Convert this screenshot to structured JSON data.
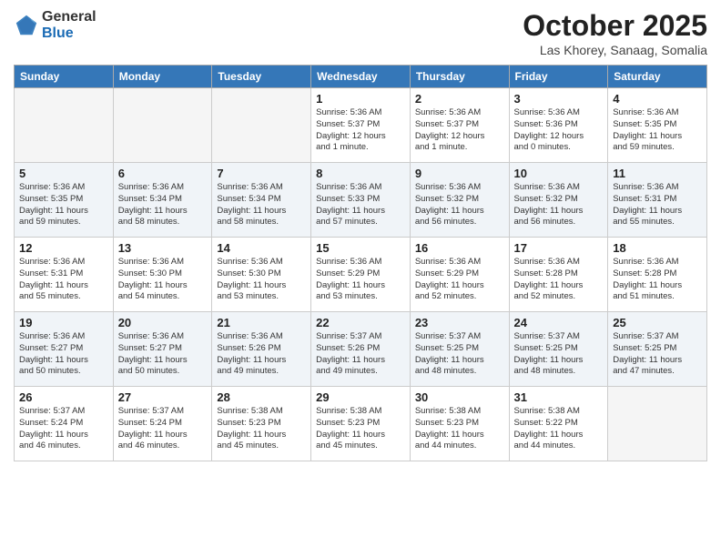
{
  "logo": {
    "general": "General",
    "blue": "Blue"
  },
  "header": {
    "month": "October 2025",
    "location": "Las Khorey, Sanaag, Somalia"
  },
  "weekdays": [
    "Sunday",
    "Monday",
    "Tuesday",
    "Wednesday",
    "Thursday",
    "Friday",
    "Saturday"
  ],
  "weeks": [
    [
      {
        "day": "",
        "info": ""
      },
      {
        "day": "",
        "info": ""
      },
      {
        "day": "",
        "info": ""
      },
      {
        "day": "1",
        "info": "Sunrise: 5:36 AM\nSunset: 5:37 PM\nDaylight: 12 hours\nand 1 minute."
      },
      {
        "day": "2",
        "info": "Sunrise: 5:36 AM\nSunset: 5:37 PM\nDaylight: 12 hours\nand 1 minute."
      },
      {
        "day": "3",
        "info": "Sunrise: 5:36 AM\nSunset: 5:36 PM\nDaylight: 12 hours\nand 0 minutes."
      },
      {
        "day": "4",
        "info": "Sunrise: 5:36 AM\nSunset: 5:35 PM\nDaylight: 11 hours\nand 59 minutes."
      }
    ],
    [
      {
        "day": "5",
        "info": "Sunrise: 5:36 AM\nSunset: 5:35 PM\nDaylight: 11 hours\nand 59 minutes."
      },
      {
        "day": "6",
        "info": "Sunrise: 5:36 AM\nSunset: 5:34 PM\nDaylight: 11 hours\nand 58 minutes."
      },
      {
        "day": "7",
        "info": "Sunrise: 5:36 AM\nSunset: 5:34 PM\nDaylight: 11 hours\nand 58 minutes."
      },
      {
        "day": "8",
        "info": "Sunrise: 5:36 AM\nSunset: 5:33 PM\nDaylight: 11 hours\nand 57 minutes."
      },
      {
        "day": "9",
        "info": "Sunrise: 5:36 AM\nSunset: 5:32 PM\nDaylight: 11 hours\nand 56 minutes."
      },
      {
        "day": "10",
        "info": "Sunrise: 5:36 AM\nSunset: 5:32 PM\nDaylight: 11 hours\nand 56 minutes."
      },
      {
        "day": "11",
        "info": "Sunrise: 5:36 AM\nSunset: 5:31 PM\nDaylight: 11 hours\nand 55 minutes."
      }
    ],
    [
      {
        "day": "12",
        "info": "Sunrise: 5:36 AM\nSunset: 5:31 PM\nDaylight: 11 hours\nand 55 minutes."
      },
      {
        "day": "13",
        "info": "Sunrise: 5:36 AM\nSunset: 5:30 PM\nDaylight: 11 hours\nand 54 minutes."
      },
      {
        "day": "14",
        "info": "Sunrise: 5:36 AM\nSunset: 5:30 PM\nDaylight: 11 hours\nand 53 minutes."
      },
      {
        "day": "15",
        "info": "Sunrise: 5:36 AM\nSunset: 5:29 PM\nDaylight: 11 hours\nand 53 minutes."
      },
      {
        "day": "16",
        "info": "Sunrise: 5:36 AM\nSunset: 5:29 PM\nDaylight: 11 hours\nand 52 minutes."
      },
      {
        "day": "17",
        "info": "Sunrise: 5:36 AM\nSunset: 5:28 PM\nDaylight: 11 hours\nand 52 minutes."
      },
      {
        "day": "18",
        "info": "Sunrise: 5:36 AM\nSunset: 5:28 PM\nDaylight: 11 hours\nand 51 minutes."
      }
    ],
    [
      {
        "day": "19",
        "info": "Sunrise: 5:36 AM\nSunset: 5:27 PM\nDaylight: 11 hours\nand 50 minutes."
      },
      {
        "day": "20",
        "info": "Sunrise: 5:36 AM\nSunset: 5:27 PM\nDaylight: 11 hours\nand 50 minutes."
      },
      {
        "day": "21",
        "info": "Sunrise: 5:36 AM\nSunset: 5:26 PM\nDaylight: 11 hours\nand 49 minutes."
      },
      {
        "day": "22",
        "info": "Sunrise: 5:37 AM\nSunset: 5:26 PM\nDaylight: 11 hours\nand 49 minutes."
      },
      {
        "day": "23",
        "info": "Sunrise: 5:37 AM\nSunset: 5:25 PM\nDaylight: 11 hours\nand 48 minutes."
      },
      {
        "day": "24",
        "info": "Sunrise: 5:37 AM\nSunset: 5:25 PM\nDaylight: 11 hours\nand 48 minutes."
      },
      {
        "day": "25",
        "info": "Sunrise: 5:37 AM\nSunset: 5:25 PM\nDaylight: 11 hours\nand 47 minutes."
      }
    ],
    [
      {
        "day": "26",
        "info": "Sunrise: 5:37 AM\nSunset: 5:24 PM\nDaylight: 11 hours\nand 46 minutes."
      },
      {
        "day": "27",
        "info": "Sunrise: 5:37 AM\nSunset: 5:24 PM\nDaylight: 11 hours\nand 46 minutes."
      },
      {
        "day": "28",
        "info": "Sunrise: 5:38 AM\nSunset: 5:23 PM\nDaylight: 11 hours\nand 45 minutes."
      },
      {
        "day": "29",
        "info": "Sunrise: 5:38 AM\nSunset: 5:23 PM\nDaylight: 11 hours\nand 45 minutes."
      },
      {
        "day": "30",
        "info": "Sunrise: 5:38 AM\nSunset: 5:23 PM\nDaylight: 11 hours\nand 44 minutes."
      },
      {
        "day": "31",
        "info": "Sunrise: 5:38 AM\nSunset: 5:22 PM\nDaylight: 11 hours\nand 44 minutes."
      },
      {
        "day": "",
        "info": ""
      }
    ]
  ]
}
